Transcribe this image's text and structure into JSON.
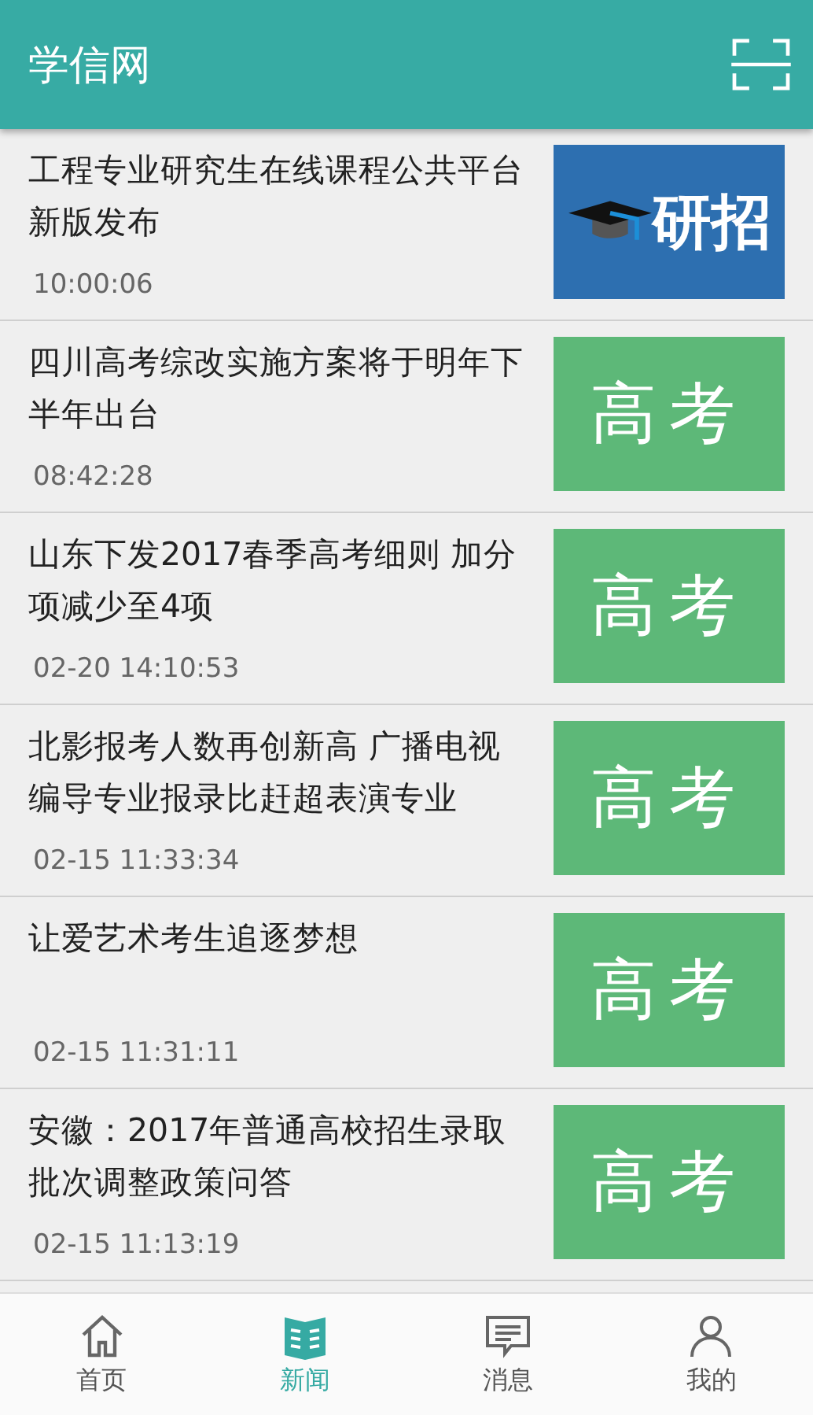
{
  "app_bar": {
    "title": "学信网"
  },
  "news": [
    {
      "title": "工程专业研究生在线课程公共平台新版发布",
      "time": "10:00:06",
      "thumb": {
        "kind": "graduate",
        "label": "研招"
      }
    },
    {
      "title": "四川高考综改实施方案将于明年下半年出台",
      "time": "08:42:28",
      "thumb": {
        "kind": "gaokao",
        "label": "高考"
      }
    },
    {
      "title": "山东下发2017春季高考细则 加分项减少至4项",
      "time": "02-20  14:10:53",
      "thumb": {
        "kind": "gaokao",
        "label": "高考"
      }
    },
    {
      "title": "北影报考人数再创新高 广播电视编导专业报录比赶超表演专业",
      "time": "02-15  11:33:34",
      "thumb": {
        "kind": "gaokao",
        "label": "高考"
      }
    },
    {
      "title": "让爱艺术考生追逐梦想",
      "time": "02-15  11:31:11",
      "thumb": {
        "kind": "gaokao",
        "label": "高考"
      }
    },
    {
      "title": "安徽：2017年普通高校招生录取批次调整政策问答",
      "time": "02-15  11:13:19",
      "thumb": {
        "kind": "gaokao",
        "label": "高考"
      }
    }
  ],
  "tabs": [
    {
      "label": "首页",
      "kind": "home",
      "selected": false
    },
    {
      "label": "新闻",
      "kind": "news",
      "selected": true
    },
    {
      "label": "消息",
      "kind": "message",
      "selected": false
    },
    {
      "label": "我的",
      "kind": "person",
      "selected": false
    }
  ]
}
